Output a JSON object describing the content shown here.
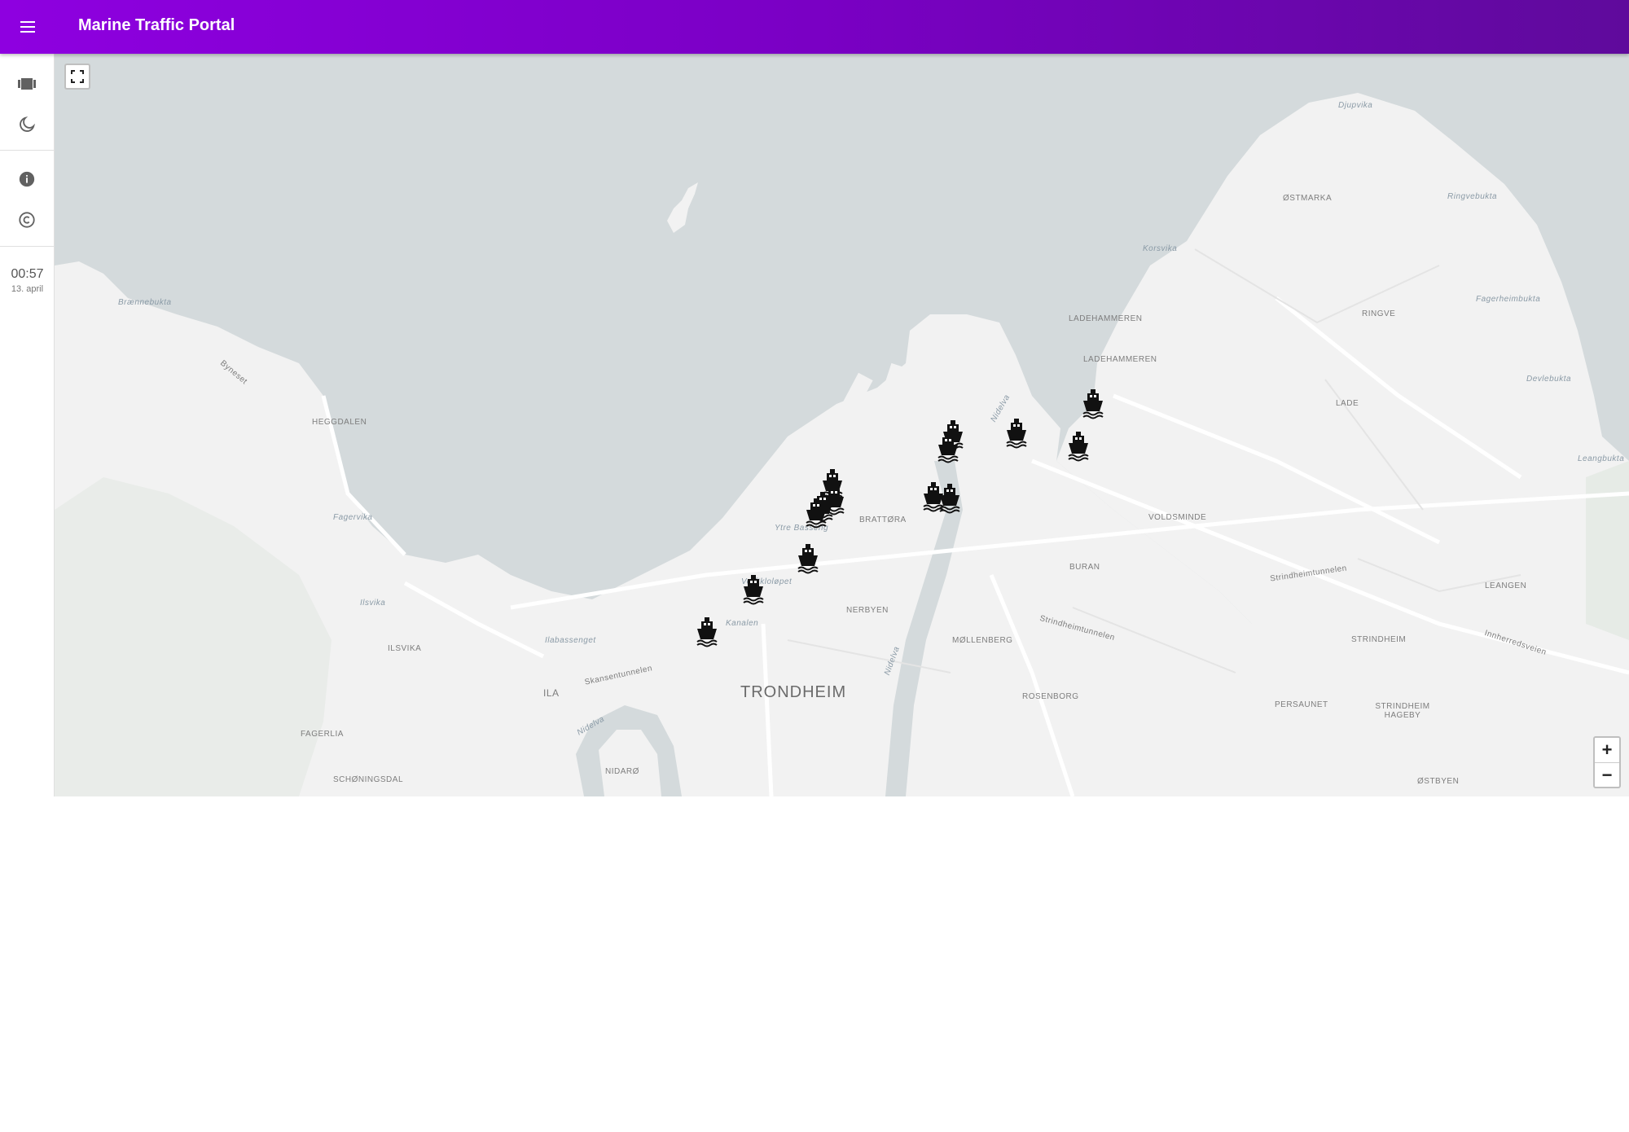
{
  "header": {
    "title": "Marine Traffic Portal"
  },
  "rail": {
    "clock": {
      "time": "00:57",
      "date": "13. april"
    }
  },
  "map": {
    "zoom_in_label": "+",
    "zoom_out_label": "−",
    "places": [
      {
        "text": "Djupvika",
        "kind": "water"
      },
      {
        "text": "ØSTMARKA",
        "kind": "area"
      },
      {
        "text": "Ringvebukta",
        "kind": "water"
      },
      {
        "text": "Korsvika",
        "kind": "water"
      },
      {
        "text": "RINGVE",
        "kind": "area"
      },
      {
        "text": "Fagerheimbukta",
        "kind": "water"
      },
      {
        "text": "LADEHAMMEREN",
        "kind": "area"
      },
      {
        "text": "LADEHAMMEREN",
        "kind": "area"
      },
      {
        "text": "Devlebukta",
        "kind": "water"
      },
      {
        "text": "LADE",
        "kind": "area"
      },
      {
        "text": "Leangbukta",
        "kind": "water"
      },
      {
        "text": "Brænnebukta",
        "kind": "water"
      },
      {
        "text": "Byneset",
        "kind": "road"
      },
      {
        "text": "HEGGDALEN",
        "kind": "area"
      },
      {
        "text": "Fagervika",
        "kind": "water"
      },
      {
        "text": "Ilsvika",
        "kind": "water"
      },
      {
        "text": "ILSVIKA",
        "kind": "area"
      },
      {
        "text": "Ilabassenget",
        "kind": "water"
      },
      {
        "text": "Skansentunnelen",
        "kind": "road"
      },
      {
        "text": "ILA",
        "kind": "area"
      },
      {
        "text": "BRATTØRA",
        "kind": "area"
      },
      {
        "text": "Ytre Basseng",
        "kind": "water"
      },
      {
        "text": "VOLDSMINDE",
        "kind": "area"
      },
      {
        "text": "BURAN",
        "kind": "area"
      },
      {
        "text": "Kanalen",
        "kind": "water"
      },
      {
        "text": "Verftkloløpet",
        "kind": "water"
      },
      {
        "text": "NERBYEN",
        "kind": "area"
      },
      {
        "text": "MØLLENBERG",
        "kind": "area"
      },
      {
        "text": "Strindheimtunnelen",
        "kind": "road"
      },
      {
        "text": "Strindheimtunnelen",
        "kind": "road"
      },
      {
        "text": "LEANGEN",
        "kind": "area"
      },
      {
        "text": "STRINDHEIM",
        "kind": "area"
      },
      {
        "text": "Innherredsveien",
        "kind": "road"
      },
      {
        "text": "TRONDHEIM",
        "kind": "city"
      },
      {
        "text": "ROSENBORG",
        "kind": "area"
      },
      {
        "text": "PERSAUNET",
        "kind": "area"
      },
      {
        "text": "STRINDHEIM HAGEBY",
        "kind": "area"
      },
      {
        "text": "FAGERLIA",
        "kind": "area"
      },
      {
        "text": "NIDARØ",
        "kind": "area"
      },
      {
        "text": "SCHØNINGSDAL",
        "kind": "area"
      },
      {
        "text": "ØSTBYEN",
        "kind": "area"
      },
      {
        "text": "Nidelva",
        "kind": "water"
      },
      {
        "text": "Nidelva",
        "kind": "water"
      },
      {
        "text": "Nidelva",
        "kind": "water"
      }
    ],
    "vessel_count": 16
  },
  "colors": {
    "appbar_start": "#8e00e0",
    "appbar_end": "#5f0a9c",
    "water": "#d4dadc",
    "land": "#f2f2f2"
  },
  "icons": [
    "menu-icon",
    "vessel-view-icon",
    "dark-mode-icon",
    "info-icon",
    "copyright-icon",
    "fullscreen-icon",
    "ship-icon"
  ]
}
